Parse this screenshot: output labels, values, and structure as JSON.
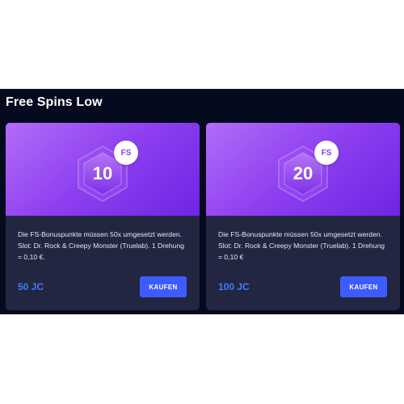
{
  "section": {
    "title": "Free Spins Low"
  },
  "cards": [
    {
      "count": "10",
      "badge": "FS",
      "description": "Die FS-Bonuspunkte müssen 50x umgesetzt werden. Slot: Dr. Rock & Creepy Monster (Truelab). 1 Drehung = 0,10 €.",
      "price": "50 JC",
      "button_label": "KAUFEN"
    },
    {
      "count": "20",
      "badge": "FS",
      "description": "Die FS-Bonuspunkte müssen 50x umgesetzt werden. Slot: Dr. Rock & Creepy Monster (Truelab). 1 Drehung = 0,10 €",
      "price": "100 JC",
      "button_label": "KAUFEN"
    }
  ],
  "colors": {
    "panel_background": "#060a1e",
    "card_background": "#222641",
    "card_header_gradient": [
      "#b36cf7",
      "#6f24e2"
    ],
    "price_text": "#3f7dff",
    "button_background": "#3d5cff"
  }
}
